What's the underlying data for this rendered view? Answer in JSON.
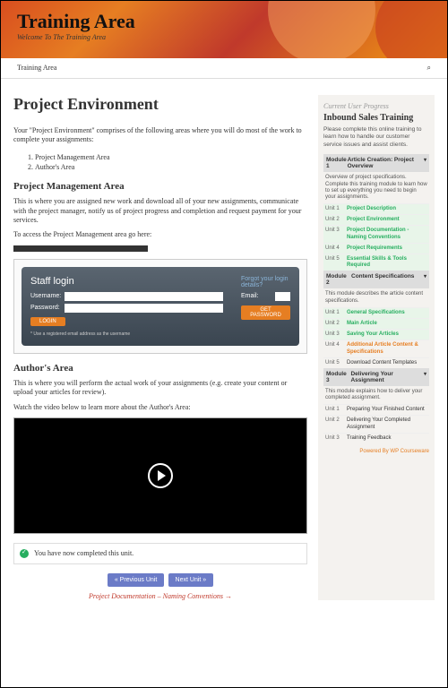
{
  "header": {
    "title": "Training Area",
    "subtitle": "Welcome To The Training Area"
  },
  "nav": {
    "breadcrumb": "Training Area"
  },
  "page": {
    "title": "Project Environment",
    "intro": "Your \"Project Environment\" comprises of the following areas where you will do most of the work to complete your assignments:",
    "areas": [
      "Project Management Area",
      "Author's Area"
    ],
    "pma_heading": "Project Management Area",
    "pma_text": "This is where you are assigned new work and download all of your new assignments, communicate with the project manager, notify us of project progress and completion and request payment for your services.",
    "pma_access": "To access the Project Management area go here:",
    "login": {
      "title": "Staff login",
      "user_label": "Username:",
      "pass_label": "Password:",
      "btn": "LOGIN",
      "forgot": "Forgot your login details?",
      "email_label": "Email:"
    },
    "aa_heading": "Author's Area",
    "aa_text": "This is where you will perform the actual work of your assignments (e.g. create your content or upload your articles for review).",
    "aa_watch": "Watch the video below to learn more about the Author's Area:",
    "completed": "You have now completed this unit.",
    "prev_btn": "« Previous Unit",
    "next_btn": "Next Unit »",
    "next_link": "Project Documentation – Naming Conventions →"
  },
  "sidebar": {
    "progress_label": "Current User Progress",
    "course_title": "Inbound Sales Training",
    "course_desc": "Please complete this online training to learn how to handle our customer service issues and assist clients.",
    "m1_label": "Module 1",
    "m1_title": "Article Creation: Project Overview",
    "m1_desc": "Overview of project specifications. Complete this training module to learn how to set up everything you need to begin your assignments.",
    "m1_units": [
      {
        "u": "Unit 1",
        "t": "Project Description",
        "s": "done"
      },
      {
        "u": "Unit 2",
        "t": "Project Environment",
        "s": "done"
      },
      {
        "u": "Unit 3",
        "t": "Project Documentation - Naming Conventions",
        "s": "done"
      },
      {
        "u": "Unit 4",
        "t": "Project Requirements",
        "s": "done"
      },
      {
        "u": "Unit 5",
        "t": "Essential Skills & Tools Required",
        "s": "done"
      }
    ],
    "m2_label": "Module 2",
    "m2_title": "Content Specifications",
    "m2_desc": "This module describes the article content specifications.",
    "m2_units": [
      {
        "u": "Unit 1",
        "t": "General Specifications",
        "s": "done"
      },
      {
        "u": "Unit 2",
        "t": "Main Article",
        "s": "done"
      },
      {
        "u": "Unit 3",
        "t": "Saving Your Articles",
        "s": "done"
      },
      {
        "u": "Unit 4",
        "t": "Additional Article Content & Specifications",
        "s": "current"
      },
      {
        "u": "Unit 5",
        "t": "Download Content Templates",
        "s": ""
      }
    ],
    "m3_label": "Module 3",
    "m3_title": "Delivering Your Assignment",
    "m3_desc": "This module explains how to deliver your completed assignment.",
    "m3_units": [
      {
        "u": "Unit 1",
        "t": "Preparing Your Finished Content",
        "s": ""
      },
      {
        "u": "Unit 2",
        "t": "Delivering Your Completed Assignment",
        "s": ""
      },
      {
        "u": "Unit 3",
        "t": "Training Feedback",
        "s": ""
      }
    ],
    "powered_label": "Powered By ",
    "powered_brand": "WP Courseware"
  }
}
